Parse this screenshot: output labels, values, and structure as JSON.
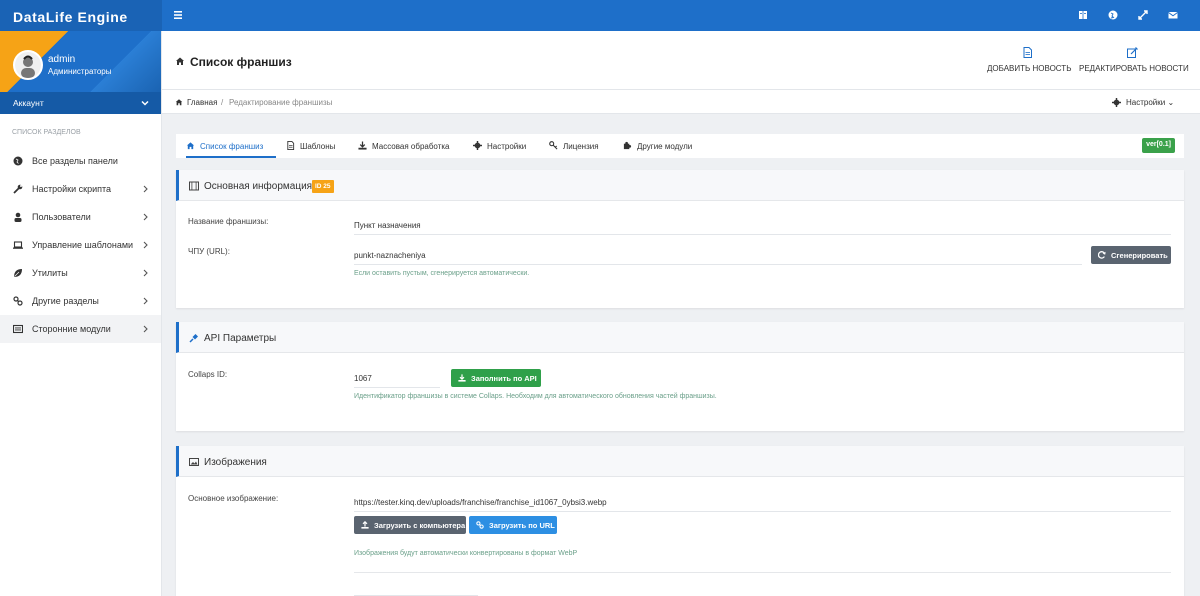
{
  "app": {
    "brand": "DataLife Engine",
    "accent": "#1e6fc9",
    "brand_dark": "#1a63b5"
  },
  "topbar": {
    "icons": [
      "menu-icon",
      "book-icon",
      "globe-icon",
      "expand-icon",
      "envelope-icon"
    ]
  },
  "sidebar": {
    "user": {
      "name": "admin",
      "group": "Администраторы"
    },
    "account_label": "Аккаунт",
    "sections_title": "Список разделов",
    "items": [
      {
        "label": "Все разделы панели",
        "icon": "globe-icon",
        "has_chevron": false
      },
      {
        "label": "Настройки скрипта",
        "icon": "wrench-icon",
        "has_chevron": true
      },
      {
        "label": "Пользователи",
        "icon": "user-icon",
        "has_chevron": true
      },
      {
        "label": "Управление шаблонами",
        "icon": "laptop-icon",
        "has_chevron": true
      },
      {
        "label": "Утилиты",
        "icon": "leaf-icon",
        "has_chevron": true
      },
      {
        "label": "Другие разделы",
        "icon": "link-icon",
        "has_chevron": true
      },
      {
        "label": "Сторонние модули",
        "icon": "list-icon",
        "has_chevron": true,
        "active": true
      }
    ]
  },
  "header": {
    "title": "Список франшиз",
    "add_news": "ДОБАВИТЬ НОВОСТЬ",
    "edit_news": "РЕДАКТИРОВАТЬ НОВОСТИ"
  },
  "breadcrumb": {
    "home": "Главная",
    "separator": "/",
    "current": "Редактирование франшизы",
    "settings": "Настройки"
  },
  "tabs": [
    {
      "label": "Список франшиз",
      "icon": "home-icon",
      "active": true
    },
    {
      "label": "Шаблоны",
      "icon": "file-icon"
    },
    {
      "label": "Массовая обработка",
      "icon": "download-icon"
    },
    {
      "label": "Настройки",
      "icon": "gear-icon"
    },
    {
      "label": "Лицензия",
      "icon": "key-icon"
    },
    {
      "label": "Другие модули",
      "icon": "puzzle-icon"
    }
  ],
  "version": "ver[0.1]",
  "basic_info": {
    "title": "Основная информация",
    "id_badge": "ID 25",
    "name_label": "Название франшизы:",
    "name_value": "Пункт назначения",
    "url_label": "ЧПУ (URL):",
    "url_value": "punkt-naznacheniya",
    "url_hint": "Если оставить пустым, сгенерируется автоматически.",
    "generate_button": "Сгенерировать"
  },
  "api": {
    "title": "API Параметры",
    "collaps_label": "Collaps ID:",
    "collaps_value": "1067",
    "fill_button": "Заполнить по API",
    "hint": "Идентификатор франшизы в системе Collaps. Необходим для автоматического обновления частей франшизы."
  },
  "images": {
    "title": "Изображения",
    "main_label": "Основное изображение:",
    "main_value": "https://tester.kinq.dev/uploads/franchise/franchise_id1067_0ybsi3.webp",
    "upload_pc_button": "Загрузить с компьютера",
    "upload_url_button": "Загрузить по URL",
    "hint": "Изображения будут автоматически конвертированы в формат WebP"
  }
}
